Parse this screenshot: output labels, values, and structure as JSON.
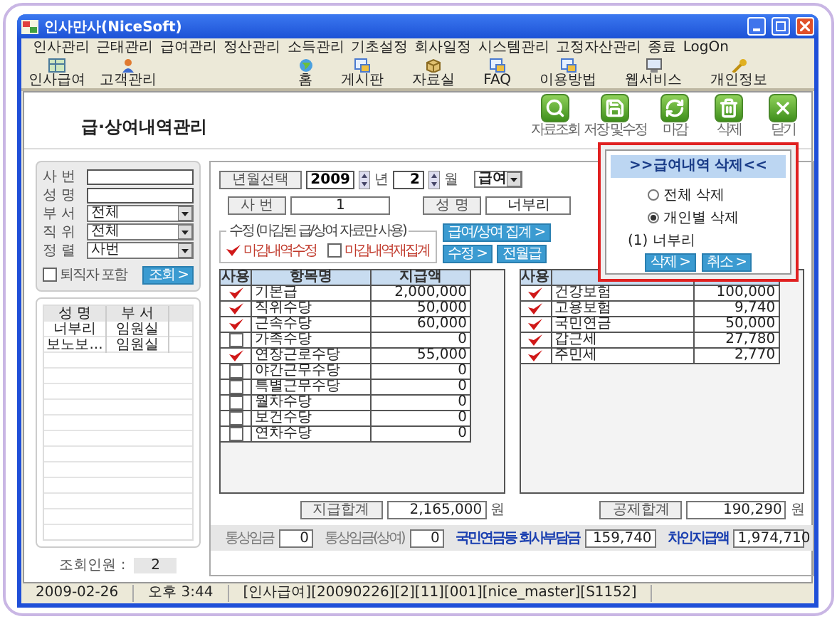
{
  "window": {
    "title": "인사만사(NiceSoft)"
  },
  "menu": [
    "인사관리",
    "근태관리",
    "급여관리",
    "정산관리",
    "소득관리",
    "기초설정",
    "회사일정",
    "시스템관리",
    "고정자산관리",
    "종료",
    "LogOn"
  ],
  "toolbar_left": [
    {
      "label": "인사급여",
      "kind": "table"
    },
    {
      "label": "고객관리",
      "kind": "person"
    }
  ],
  "toolbar_right": [
    {
      "label": "홈",
      "kind": "globe"
    },
    {
      "label": "게시판",
      "kind": "window"
    },
    {
      "label": "자료실",
      "kind": "box"
    },
    {
      "label": "FAQ",
      "kind": "window"
    },
    {
      "label": "이용방법",
      "kind": "window"
    },
    {
      "label": "웹서비스",
      "kind": "monitor"
    },
    {
      "label": "개인정보",
      "kind": "key"
    }
  ],
  "page_title": "급·상여내역관리",
  "actions": [
    {
      "label": "자료조회",
      "kind": "search"
    },
    {
      "label": "저장 및수정",
      "kind": "save"
    },
    {
      "label": "마감",
      "kind": "refresh"
    },
    {
      "label": "삭제",
      "kind": "trash"
    },
    {
      "label": "닫기",
      "kind": "close"
    }
  ],
  "search": {
    "fields": [
      {
        "label": "사 번",
        "kind": "text"
      },
      {
        "label": "성 명",
        "kind": "text"
      },
      {
        "label": "부 서",
        "kind": "select",
        "value": "전체"
      },
      {
        "label": "직 위",
        "kind": "select",
        "value": "전체"
      },
      {
        "label": "정 렬",
        "kind": "select",
        "value": "사번"
      }
    ],
    "retired": {
      "label": "퇴직자 포함",
      "checked": false
    },
    "button": "조회 >"
  },
  "employee_list": {
    "columns": [
      "성 명",
      "부 서"
    ],
    "rows": [
      {
        "name": "너부리",
        "dept": "임원실",
        "selected": false
      },
      {
        "name": "보노보...",
        "dept": "임원실",
        "selected": false
      }
    ],
    "count_label": "조회인원 :",
    "count": "2"
  },
  "period": {
    "label": "년월선택",
    "year": "2009",
    "year_unit": "년",
    "month": "2",
    "month_unit": "월",
    "type": "급여"
  },
  "employee": {
    "id_label": "사 번",
    "id": "1",
    "name_label": "성 명",
    "name": "너부리"
  },
  "edit_group": {
    "legend": "수정 (마감된 급/상여 자료만 사용)",
    "options": [
      {
        "label": "마감내역수정",
        "checked": true
      },
      {
        "label": "마감내역재집계",
        "checked": false
      }
    ],
    "buttons": [
      "급여/상여 집계 >",
      "수정 >",
      "전월급"
    ]
  },
  "payments": {
    "columns": [
      "사용",
      "항목명",
      "지급액"
    ],
    "rows": [
      {
        "used": true,
        "name": "기본급",
        "amount": "2,000,000"
      },
      {
        "used": true,
        "name": "직위수당",
        "amount": "50,000"
      },
      {
        "used": true,
        "name": "근속수당",
        "amount": "60,000"
      },
      {
        "used": false,
        "name": "가족수당",
        "amount": "0"
      },
      {
        "used": true,
        "name": "연장근로수당",
        "amount": "55,000"
      },
      {
        "used": false,
        "name": "야간근무수당",
        "amount": "0"
      },
      {
        "used": false,
        "name": "특별근무수당",
        "amount": "0"
      },
      {
        "used": false,
        "name": "월차수당",
        "amount": "0"
      },
      {
        "used": false,
        "name": "보건수당",
        "amount": "0"
      },
      {
        "used": false,
        "name": "연차수당",
        "amount": "0"
      }
    ],
    "total_label": "지급합계",
    "total": "2,165,000",
    "unit": "원"
  },
  "deductions": {
    "columns": [
      "사용"
    ],
    "rows": [
      {
        "used": true,
        "name": "건강보험",
        "amount": "100,000"
      },
      {
        "used": true,
        "name": "고용보험",
        "amount": "9,740"
      },
      {
        "used": true,
        "name": "국민연금",
        "amount": "50,000"
      },
      {
        "used": true,
        "name": "갑근세",
        "amount": "27,780"
      },
      {
        "used": true,
        "name": "주민세",
        "amount": "2,770"
      }
    ],
    "total_label": "공제합계",
    "total": "190,290",
    "unit": "원"
  },
  "summary": [
    {
      "label": "통상임금",
      "value": "0",
      "emphasis": false
    },
    {
      "label": "통상임금(상여)",
      "value": "0",
      "emphasis": false
    },
    {
      "label": "국민연금등 회사부담금",
      "value": "159,740",
      "emphasis": true
    },
    {
      "label": "차인지급액",
      "value": "1,974,710",
      "emphasis": true
    }
  ],
  "status_bar": [
    "2009-02-26",
    "오후 3:44",
    "[인사급여][20090226][2][11][001][nice_master][S1152]"
  ],
  "dialog": {
    "title": ">>급여내역 삭제<<",
    "options": [
      {
        "label": "전체 삭제",
        "selected": false
      },
      {
        "label": "개인별 삭제",
        "selected": true
      }
    ],
    "target": "(1) 너부리",
    "buttons": [
      "삭제 >",
      "취소 >"
    ]
  }
}
